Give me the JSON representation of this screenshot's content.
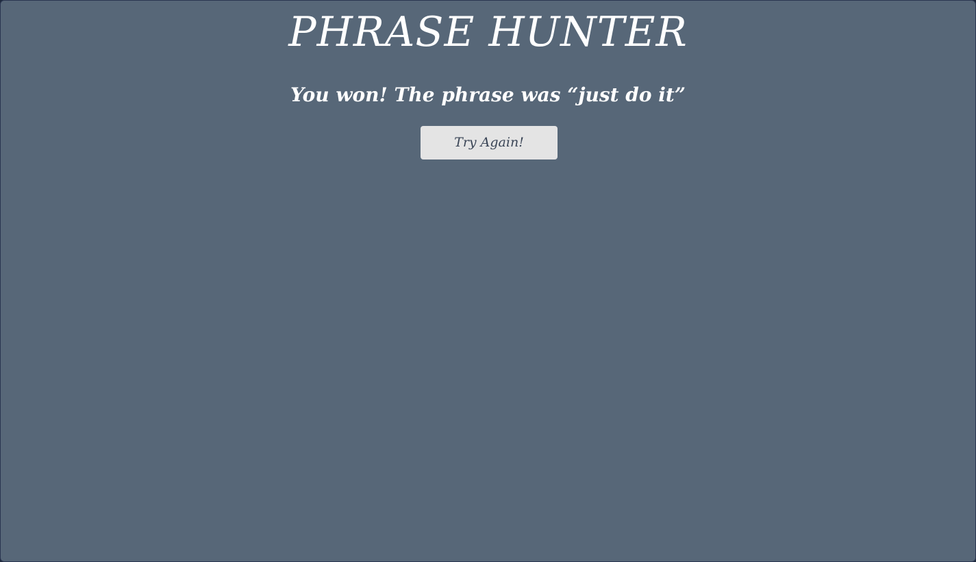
{
  "game": {
    "title": "PHRASE HUNTER",
    "result_message": "You won! The phrase was “just do it”",
    "try_again_label": "Try Again!"
  },
  "colors": {
    "background": "#576778",
    "button_background": "#e4e4e4",
    "button_text": "#3a4556",
    "text": "#ffffff"
  }
}
